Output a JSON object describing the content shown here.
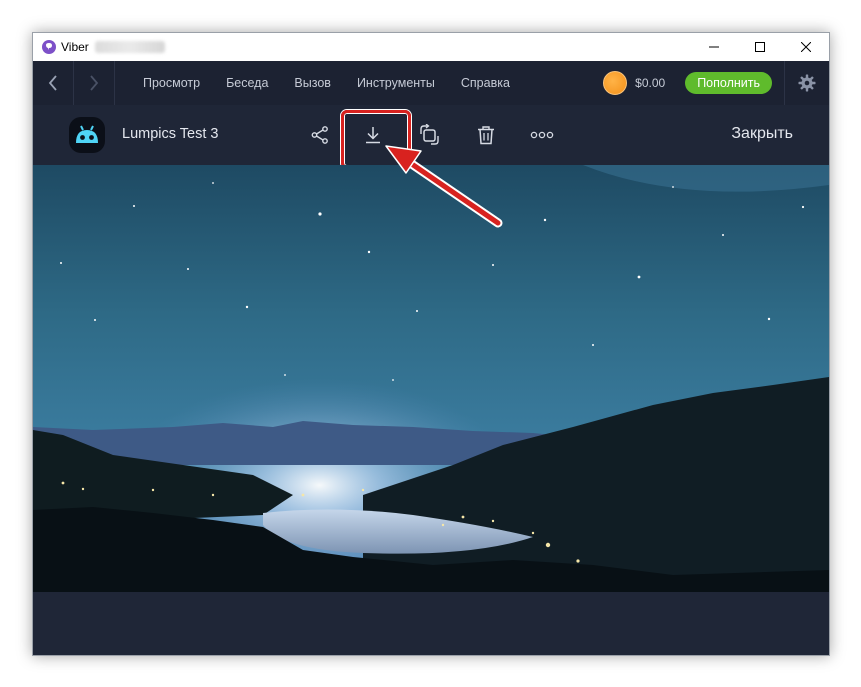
{
  "window": {
    "app_title": "Viber"
  },
  "menubar": {
    "items": [
      {
        "label": "Просмотр"
      },
      {
        "label": "Беседа"
      },
      {
        "label": "Вызов"
      },
      {
        "label": "Инструменты"
      },
      {
        "label": "Справка"
      }
    ],
    "balance": "$0.00",
    "topup_label": "Пополнить"
  },
  "viewer": {
    "contact_name": "Lumpics Test 3",
    "close_label": "Закрыть",
    "tools": [
      "share-icon",
      "download-icon",
      "rotate-icon",
      "trash-icon",
      "more-icon"
    ]
  },
  "colors": {
    "accent_purple": "#7d50c8",
    "topup_green": "#5fbb2c",
    "annotation_red": "#d8221f",
    "toolbar_bg": "#1f2637"
  }
}
